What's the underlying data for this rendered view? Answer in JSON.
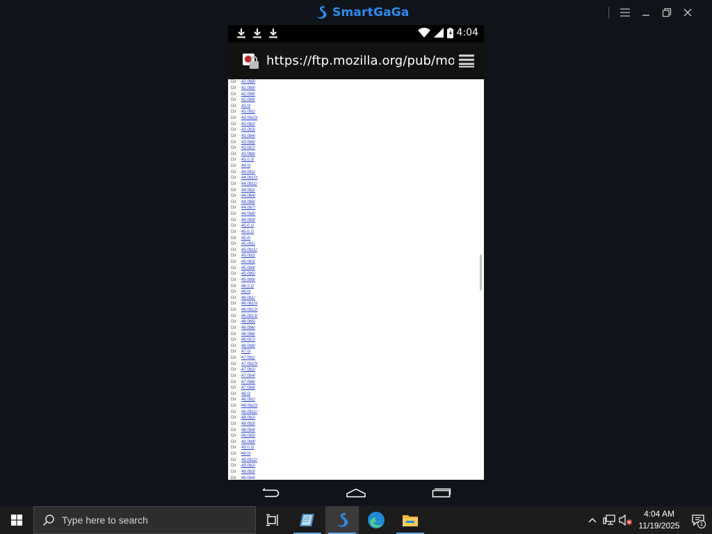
{
  "emulator": {
    "title": "SmartGaGa",
    "brand_color": "#2a8cf0"
  },
  "phone": {
    "status_bar": {
      "time": "4:04",
      "left_icons": [
        "download-icon",
        "download-icon",
        "download-icon"
      ],
      "right_icons": [
        "wifi-icon",
        "signal-icon",
        "battery-icon"
      ]
    },
    "browser": {
      "url": "https://ftp.mozilla.org/pub/mo"
    },
    "listing": [
      {
        "type": "Dir",
        "name": "42.0b8/"
      },
      {
        "type": "Dir",
        "name": "42.0b9/"
      },
      {
        "type": "Dir",
        "name": "42.0b9/"
      },
      {
        "type": "Dir",
        "name": "42.0b9/"
      },
      {
        "type": "Dir",
        "name": "43.0/"
      },
      {
        "type": "Dir",
        "name": "43.0b1/"
      },
      {
        "type": "Dir",
        "name": "43.0b10/"
      },
      {
        "type": "Dir",
        "name": "43.0b2/"
      },
      {
        "type": "Dir",
        "name": "43.0b3/"
      },
      {
        "type": "Dir",
        "name": "43.0b4/"
      },
      {
        "type": "Dir",
        "name": "43.0b5/"
      },
      {
        "type": "Dir",
        "name": "43.0b7/"
      },
      {
        "type": "Dir",
        "name": "43.0b8/"
      },
      {
        "type": "Dir",
        "name": "43.0.3/"
      },
      {
        "type": "Dir",
        "name": "44.0/"
      },
      {
        "type": "Dir",
        "name": "44.0b1/"
      },
      {
        "type": "Dir",
        "name": "44.0b10/"
      },
      {
        "type": "Dir",
        "name": "44.0b11/"
      },
      {
        "type": "Dir",
        "name": "44.0b2/"
      },
      {
        "type": "Dir",
        "name": "44.0b4/"
      },
      {
        "type": "Dir",
        "name": "44.0b6/"
      },
      {
        "type": "Dir",
        "name": "44.0b7/"
      },
      {
        "type": "Dir",
        "name": "44.0b8/"
      },
      {
        "type": "Dir",
        "name": "44.0b9/"
      },
      {
        "type": "Dir",
        "name": "45.0.1/"
      },
      {
        "type": "Dir",
        "name": "45.0.2/"
      },
      {
        "type": "Dir",
        "name": "45.0/"
      },
      {
        "type": "Dir",
        "name": "45.0b1/"
      },
      {
        "type": "Dir",
        "name": "45.0b11/"
      },
      {
        "type": "Dir",
        "name": "45.0b2/"
      },
      {
        "type": "Dir",
        "name": "45.0b3/"
      },
      {
        "type": "Dir",
        "name": "45.0b4/"
      },
      {
        "type": "Dir",
        "name": "45.0b5/"
      },
      {
        "type": "Dir",
        "name": "45.0b9/"
      },
      {
        "type": "Dir",
        "name": "46.0.1/"
      },
      {
        "type": "Dir",
        "name": "46.0/"
      },
      {
        "type": "Dir",
        "name": "46.0b1/"
      },
      {
        "type": "Dir",
        "name": "46.0b10/"
      },
      {
        "type": "Dir",
        "name": "46.0b12/"
      },
      {
        "type": "Dir",
        "name": "46.0b13/"
      },
      {
        "type": "Dir",
        "name": "46.0b5/"
      },
      {
        "type": "Dir",
        "name": "46.0b6/"
      },
      {
        "type": "Dir",
        "name": "46.0b6/"
      },
      {
        "type": "Dir",
        "name": "46.0b7/"
      },
      {
        "type": "Dir",
        "name": "46.0b8/"
      },
      {
        "type": "Dir",
        "name": "47.0/"
      },
      {
        "type": "Dir",
        "name": "47.0b1/"
      },
      {
        "type": "Dir",
        "name": "47.0b10/"
      },
      {
        "type": "Dir",
        "name": "47.0b2/"
      },
      {
        "type": "Dir",
        "name": "47.0b4/"
      },
      {
        "type": "Dir",
        "name": "47.0b6/"
      },
      {
        "type": "Dir",
        "name": "47.0b8/"
      },
      {
        "type": "Dir",
        "name": "48.0/"
      },
      {
        "type": "Dir",
        "name": "48.0b1/"
      },
      {
        "type": "Dir",
        "name": "48.0b10/"
      },
      {
        "type": "Dir",
        "name": "48.0b11/"
      },
      {
        "type": "Dir",
        "name": "48.0b2/"
      },
      {
        "type": "Dir",
        "name": "48.0b3/"
      },
      {
        "type": "Dir",
        "name": "48.0b4/"
      },
      {
        "type": "Dir",
        "name": "48.0b5/"
      },
      {
        "type": "Dir",
        "name": "48.0b9/"
      },
      {
        "type": "Dir",
        "name": "49.0.2/"
      },
      {
        "type": "Dir",
        "name": "49.0/"
      },
      {
        "type": "Dir",
        "name": "49.0b11/"
      },
      {
        "type": "Dir",
        "name": "49.0b2/"
      },
      {
        "type": "Dir",
        "name": "49.0b3/"
      },
      {
        "type": "Dir",
        "name": "49.0b4/"
      }
    ]
  },
  "taskbar": {
    "search_placeholder": "Type here to search",
    "clock_time": "4:04 AM",
    "clock_date": "11/19/2025",
    "notification_count": "1"
  }
}
